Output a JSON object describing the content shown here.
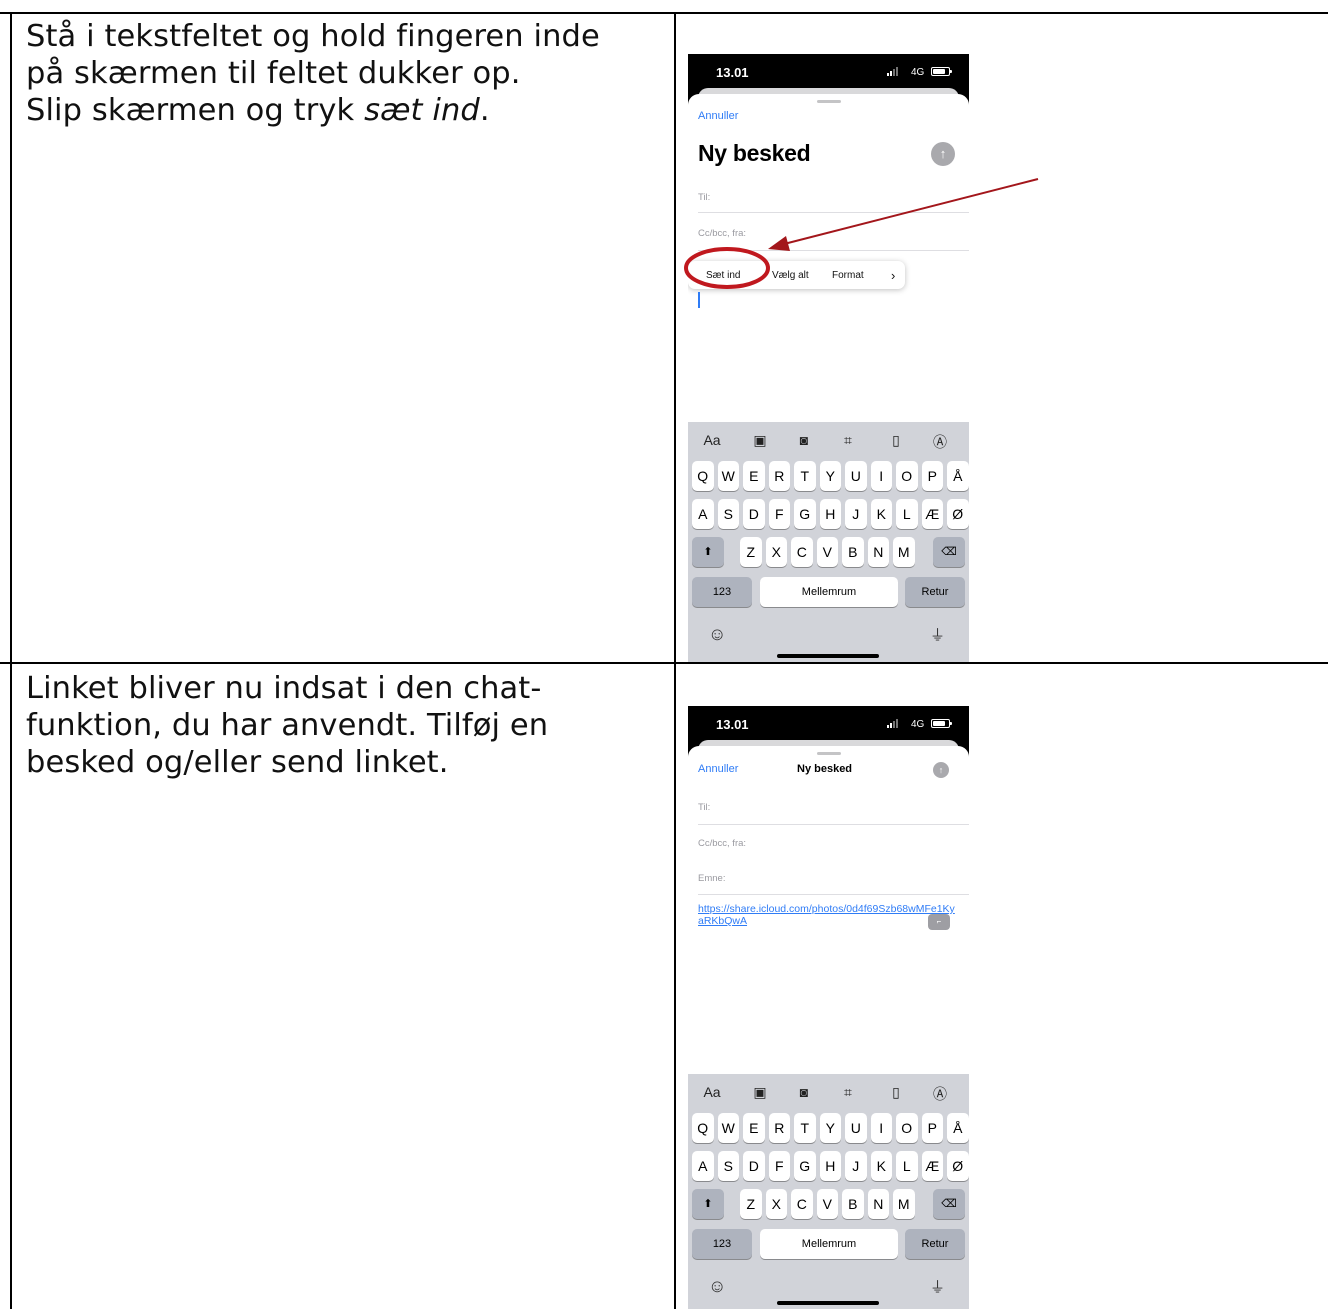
{
  "rows": [
    {
      "lines": [
        "Stå i tekstfeltet og hold fingeren inde",
        "på skærmen til feltet dukker op."
      ],
      "line3_prefix": "Slip skærmen og tryk ",
      "line3_emphasis": "sæt ind",
      "line3_suffix": "."
    },
    {
      "lines": [
        "Linket bliver nu indsat i den chat-",
        "funktion, du har anvendt. Tilføj en",
        "besked og/eller send linket."
      ]
    }
  ],
  "phones": [
    {
      "status": {
        "time": "13.01",
        "network": "4G"
      },
      "cancel": "Annuller",
      "title": "Ny besked",
      "fields": {
        "to": "Til:",
        "cc": "Cc/bcc, fra:"
      },
      "menu": [
        "Sæt ind",
        "Vælg alt",
        "Format",
        "›"
      ]
    },
    {
      "status": {
        "time": "13.01",
        "network": "4G"
      },
      "cancel": "Annuller",
      "title": "Ny besked",
      "fields": {
        "to": "Til:",
        "cc": "Cc/bcc, fra:",
        "subject": "Emne:"
      },
      "link": "https://share.icloud.com/photos/0d4f69Szb68wMFe1KyaRKbQwA"
    }
  ],
  "keyboard": {
    "tools": [
      "Aa",
      "photo-icon",
      "camera-icon",
      "scan-icon",
      "file-icon",
      "markup-icon"
    ],
    "row1": [
      "Q",
      "W",
      "E",
      "R",
      "T",
      "Y",
      "U",
      "I",
      "O",
      "P",
      "Å"
    ],
    "row2": [
      "A",
      "S",
      "D",
      "F",
      "G",
      "H",
      "J",
      "K",
      "L",
      "Æ",
      "Ø"
    ],
    "row3": [
      "Z",
      "X",
      "C",
      "V",
      "B",
      "N",
      "M"
    ],
    "numbers": "123",
    "space": "Mellemrum",
    "return": "Retur"
  },
  "colors": {
    "link": "#2f7cf6",
    "annotation": "#c0181e",
    "keyboard": "#d1d3d9"
  }
}
